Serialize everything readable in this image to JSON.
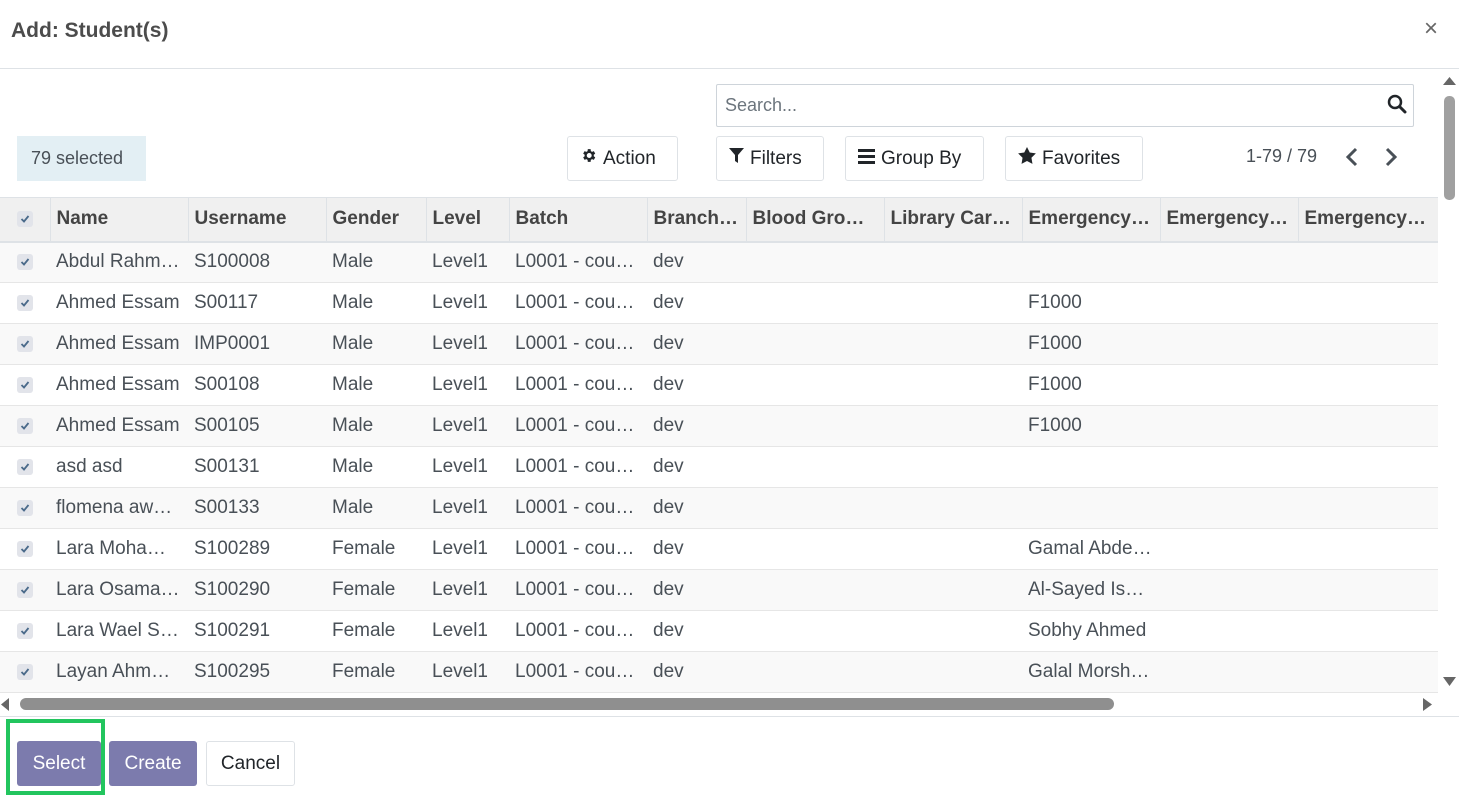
{
  "dialog": {
    "title": "Add: Student(s)",
    "close_icon": "×"
  },
  "search": {
    "placeholder": "Search..."
  },
  "selection": {
    "label": "79 selected"
  },
  "toolbar": {
    "action": "Action",
    "filters": "Filters",
    "group_by": "Group By",
    "favorites": "Favorites"
  },
  "pager": {
    "range": "1-79 / 79"
  },
  "table": {
    "columns": [
      "Name",
      "Username",
      "Gender",
      "Level",
      "Batch",
      "Branch…",
      "Blood Gro…",
      "Library Car…",
      "Emergency…",
      "Emergency…",
      "Emergency…"
    ],
    "rows": [
      [
        "Abdul Rahm…",
        "S100008",
        "Male",
        "Level1",
        "L0001 - cou…",
        "dev",
        "",
        "",
        "",
        "",
        ""
      ],
      [
        "Ahmed Essam",
        "S00117",
        "Male",
        "Level1",
        "L0001 - cou…",
        "dev",
        "",
        "",
        "F1000",
        "",
        ""
      ],
      [
        "Ahmed Essam",
        "IMP0001",
        "Male",
        "Level1",
        "L0001 - cou…",
        "dev",
        "",
        "",
        "F1000",
        "",
        ""
      ],
      [
        "Ahmed Essam",
        "S00108",
        "Male",
        "Level1",
        "L0001 - cou…",
        "dev",
        "",
        "",
        "F1000",
        "",
        ""
      ],
      [
        "Ahmed Essam",
        "S00105",
        "Male",
        "Level1",
        "L0001 - cou…",
        "dev",
        "",
        "",
        "F1000",
        "",
        ""
      ],
      [
        "asd asd",
        "S00131",
        "Male",
        "Level1",
        "L0001 - cou…",
        "dev",
        "",
        "",
        "",
        "",
        ""
      ],
      [
        "flomena aw…",
        "S00133",
        "Male",
        "Level1",
        "L0001 - cou…",
        "dev",
        "",
        "",
        "",
        "",
        ""
      ],
      [
        "Lara Moha…",
        "S100289",
        "Female",
        "Level1",
        "L0001 - cou…",
        "dev",
        "",
        "",
        "Gamal Abde…",
        "",
        ""
      ],
      [
        "Lara Osama…",
        "S100290",
        "Female",
        "Level1",
        "L0001 - cou…",
        "dev",
        "",
        "",
        "Al-Sayed Is…",
        "",
        ""
      ],
      [
        "Lara Wael S…",
        "S100291",
        "Female",
        "Level1",
        "L0001 - cou…",
        "dev",
        "",
        "",
        "Sobhy Ahmed",
        "",
        ""
      ],
      [
        "Layan Ahm…",
        "S100295",
        "Female",
        "Level1",
        "L0001 - cou…",
        "dev",
        "",
        "",
        "Galal Morsh…",
        "",
        ""
      ]
    ]
  },
  "footer": {
    "select": "Select",
    "create": "Create",
    "cancel": "Cancel"
  },
  "colors": {
    "primary": "#7c7bad",
    "highlight": "#22c55e",
    "selected_bg": "#e3eff4"
  }
}
